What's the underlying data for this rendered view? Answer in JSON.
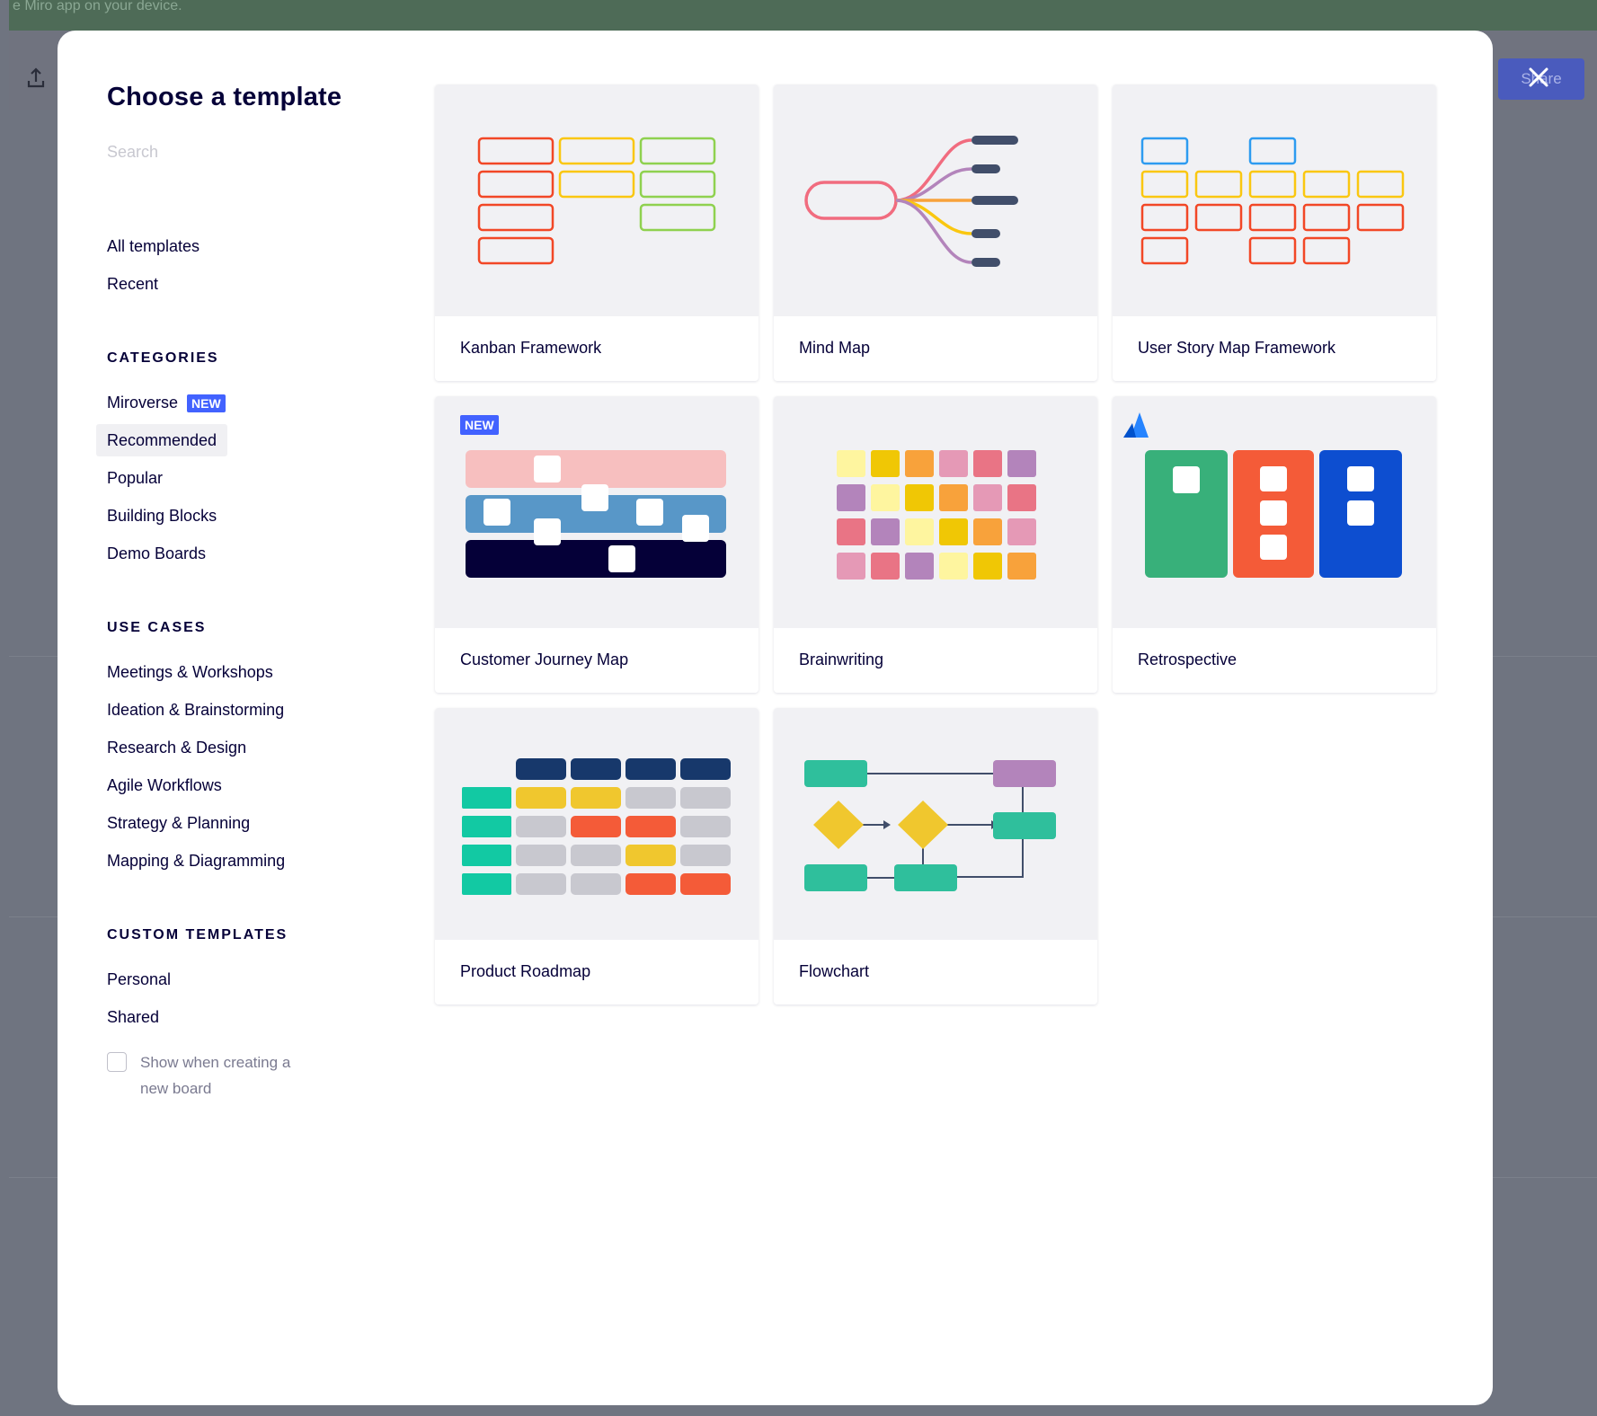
{
  "background_app": {
    "banner_text": "e Miro app on your device.",
    "share_label": "Share"
  },
  "modal": {
    "title": "Choose a template",
    "search_placeholder": "Search",
    "nav": {
      "all_templates": "All templates",
      "recent": "Recent"
    },
    "categories_heading": "CATEGORIES",
    "categories": [
      {
        "label": "Miroverse",
        "badge": "NEW"
      },
      {
        "label": "Recommended"
      },
      {
        "label": "Popular"
      },
      {
        "label": "Building Blocks"
      },
      {
        "label": "Demo Boards"
      }
    ],
    "use_cases_heading": "USE CASES",
    "use_cases": [
      "Meetings & Workshops",
      "Ideation & Brainstorming",
      "Research & Design",
      "Agile Workflows",
      "Strategy & Planning",
      "Mapping & Diagramming"
    ],
    "custom_heading": "CUSTOM TEMPLATES",
    "custom": [
      "Personal",
      "Shared"
    ],
    "show_checkbox_label": "Show when creating a new board",
    "show_checkbox_checked": false
  },
  "templates": [
    {
      "title": "Kanban Framework",
      "preview": "kanban"
    },
    {
      "title": "Mind Map",
      "preview": "mindmap"
    },
    {
      "title": "User Story Map Framework",
      "preview": "userstory"
    },
    {
      "title": "Customer Journey Map",
      "preview": "journey",
      "badge": "NEW"
    },
    {
      "title": "Brainwriting",
      "preview": "brainwriting"
    },
    {
      "title": "Retrospective",
      "preview": "retro",
      "icon": "atlassian-logo-icon"
    },
    {
      "title": "Product Roadmap",
      "preview": "roadmap"
    },
    {
      "title": "Flowchart",
      "preview": "flowchart"
    }
  ],
  "colors": {
    "accent": "#4262ff",
    "text": "#050038",
    "red": "#f24726",
    "yellow": "#fac710",
    "green": "#8fd14f",
    "blue": "#2d9bf0",
    "pink": "#ea94bb",
    "purple": "#9510ac",
    "teal": "#12cdd4",
    "navy": "#050038"
  }
}
